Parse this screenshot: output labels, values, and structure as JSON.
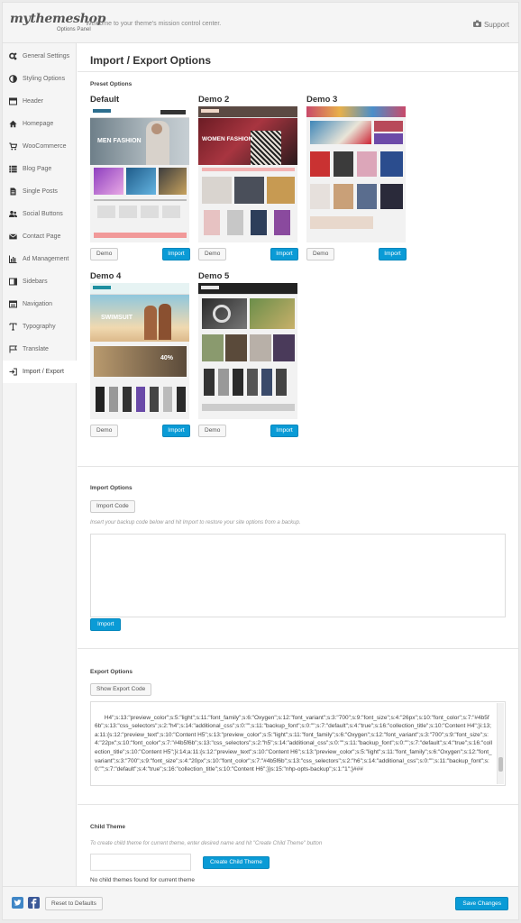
{
  "header": {
    "logo": "mythemeshop",
    "logo_sub": "Options Panel",
    "welcome": "Welcome to your theme's mission control center.",
    "support": "Support"
  },
  "sidebar": {
    "items": [
      {
        "label": "General Settings",
        "icon": "gears-icon"
      },
      {
        "label": "Styling Options",
        "icon": "contrast-icon"
      },
      {
        "label": "Header",
        "icon": "header-icon"
      },
      {
        "label": "Homepage",
        "icon": "home-icon"
      },
      {
        "label": "WooCommerce",
        "icon": "cart-icon"
      },
      {
        "label": "Blog Page",
        "icon": "list-icon"
      },
      {
        "label": "Single Posts",
        "icon": "document-icon"
      },
      {
        "label": "Social Buttons",
        "icon": "users-icon"
      },
      {
        "label": "Contact Page",
        "icon": "envelope-icon"
      },
      {
        "label": "Ad Management",
        "icon": "bar-chart-icon"
      },
      {
        "label": "Sidebars",
        "icon": "sidebar-icon"
      },
      {
        "label": "Navigation",
        "icon": "navigation-icon"
      },
      {
        "label": "Typography",
        "icon": "typography-icon"
      },
      {
        "label": "Translate",
        "icon": "flag-icon"
      },
      {
        "label": "Import / Export",
        "icon": "sign-in-icon"
      }
    ]
  },
  "main": {
    "title": "Import / Export Options",
    "preset": {
      "section_title": "Preset Options",
      "demo_button": "Demo",
      "import_button": "Import",
      "demos": [
        {
          "name": "Default",
          "hero_text": "MEN FASHION"
        },
        {
          "name": "Demo 2",
          "hero_text": "WOMEN FASHION"
        },
        {
          "name": "Demo 3",
          "hero_text": ""
        },
        {
          "name": "Demo 4",
          "hero_text": "SWIMSUIT"
        },
        {
          "name": "Demo 5",
          "hero_text": ""
        }
      ]
    },
    "import_options": {
      "section_title": "Import Options",
      "import_code_button": "Import Code",
      "hint": "Insert your backup code below and hit Import to restore your site options from a backup.",
      "import_button": "Import",
      "textarea_value": ""
    },
    "export_options": {
      "section_title": "Export Options",
      "show_export_button": "Show Export Code",
      "code": "H4\";s:13:\"preview_color\";s:5:\"light\";s:11:\"font_family\";s:6:\"Oxygen\";s:12:\"font_variant\";s:3:\"700\";s:9:\"font_size\";s:4:\"26px\";s:10:\"font_color\";s:7:\"#4b5f6b\";s:13:\"css_selectors\";s:2:\"h4\";s:14:\"additional_css\";s:0:\"\";s:11:\"backup_font\";s:0:\"\";s:7:\"default\";s:4:\"true\";s:16:\"collection_title\";s:10:\"Content H4\";}i:13;a:11:{s:12:\"preview_text\";s:10:\"Content H5\";s:13:\"preview_color\";s:5:\"light\";s:11:\"font_family\";s:6:\"Oxygen\";s:12:\"font_variant\";s:3:\"700\";s:9:\"font_size\";s:4:\"22px\";s:10:\"font_color\";s:7:\"#4b5f6b\";s:13:\"css_selectors\";s:2:\"h5\";s:14:\"additional_css\";s:0:\"\";s:11:\"backup_font\";s:0:\"\";s:7:\"default\";s:4:\"true\";s:16:\"collection_title\";s:10:\"Content H5\";}i:14;a:11:{s:12:\"preview_text\";s:10:\"Content H6\";s:13:\"preview_color\";s:5:\"light\";s:11:\"font_family\";s:6:\"Oxygen\";s:12:\"font_variant\";s:3:\"700\";s:9:\"font_size\";s:4:\"20px\";s:10:\"font_color\";s:7:\"#4b5f6b\";s:13:\"css_selectors\";s:2:\"h6\";s:14:\"additional_css\";s:0:\"\";s:11:\"backup_font\";s:0:\"\";s:7:\"default\";s:4:\"true\";s:16:\"collection_title\";s:10:\"Content H6\";}}s:15:\"nhp-opts-backup\";s:1:\"1\";}###"
    },
    "child_theme": {
      "section_title": "Child Theme",
      "hint": "To create child theme for current theme, enter desired name and hit \"Create Child Theme\" button",
      "name_value": "",
      "create_button": "Create Child Theme",
      "status": "No child themes found for current theme"
    }
  },
  "footer": {
    "reset_button": "Reset to Defaults",
    "save_button": "Save Changes",
    "twitter_icon": "twitter-icon",
    "facebook_icon": "facebook-icon"
  },
  "colors": {
    "accent": "#0a9bd6",
    "twitter": "#3f86c6",
    "facebook": "#3b5998"
  }
}
